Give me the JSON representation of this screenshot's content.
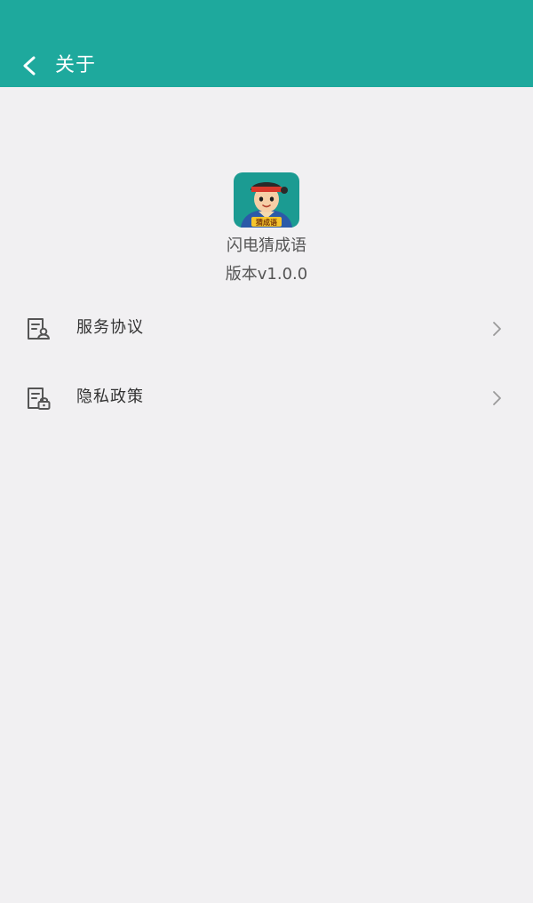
{
  "header": {
    "title": "关于",
    "back_icon": "chevron-left-icon",
    "background_color": "#1ea99d"
  },
  "app": {
    "name": "闪电猜成语",
    "version": "版本v1.0.0",
    "icon_banner_text": "猜成语"
  },
  "menu": {
    "items": [
      {
        "label": "服务协议",
        "icon": "document-user-icon"
      },
      {
        "label": "隐私政策",
        "icon": "document-lock-icon"
      }
    ],
    "chevron_icon": "chevron-right-icon"
  }
}
